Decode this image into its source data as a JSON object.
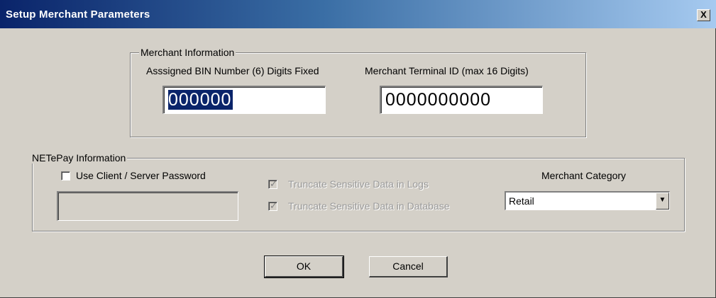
{
  "window": {
    "title": "Setup Merchant Parameters",
    "close_label": "X"
  },
  "merchant_info": {
    "legend": "Merchant Information",
    "bin_label": "Asssigned BIN Number (6) Digits Fixed",
    "bin_value": "000000",
    "terminal_label": "Merchant Terminal ID (max 16 Digits)",
    "terminal_value": "0000000000"
  },
  "netepay_info": {
    "legend": "NETePay Information",
    "password_checkbox_label": "Use Client / Server Password",
    "password_checked": false,
    "password_value": "",
    "truncate_logs_label": "Truncate Sensitive Data in Logs",
    "truncate_logs_checked": true,
    "truncate_db_label": "Truncate Sensitive Data in Database",
    "truncate_db_checked": true,
    "category_label": "Merchant Category",
    "category_value": "Retail"
  },
  "buttons": {
    "ok_label": "OK",
    "cancel_label": "Cancel"
  },
  "colors": {
    "title_start": "#0a246a",
    "title_end": "#a6caf0",
    "face": "#d4d0c8",
    "selection": "#0a246a"
  },
  "icons": {
    "close": "close-icon",
    "dropdown": "chevron-down-icon",
    "check": "checkmark-icon"
  }
}
